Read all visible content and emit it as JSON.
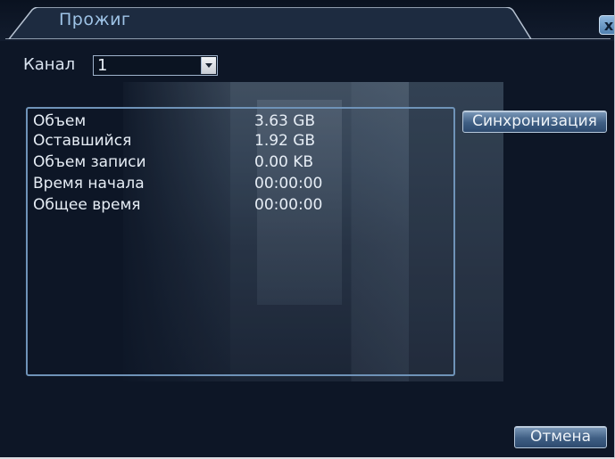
{
  "window": {
    "title": "Прожиг",
    "close_glyph": "x"
  },
  "channel": {
    "label": "Канал",
    "selected": "1"
  },
  "info": {
    "rows": [
      {
        "label": "Объем",
        "value": "3.63 GB"
      },
      {
        "label": "Оставшийся",
        "value": "1.92 GB"
      },
      {
        "label": "Объем записи",
        "value": "0.00 KB"
      },
      {
        "label": "Время начала",
        "value": "00:00:00"
      },
      {
        "label": "Общее время",
        "value": "00:00:00"
      }
    ]
  },
  "buttons": {
    "sync_label": "Синхронизация",
    "cancel_label": "Отмена"
  },
  "colors": {
    "background": "#0d1626",
    "accent": "#6f93b8",
    "title_text": "#9ec3e6"
  }
}
